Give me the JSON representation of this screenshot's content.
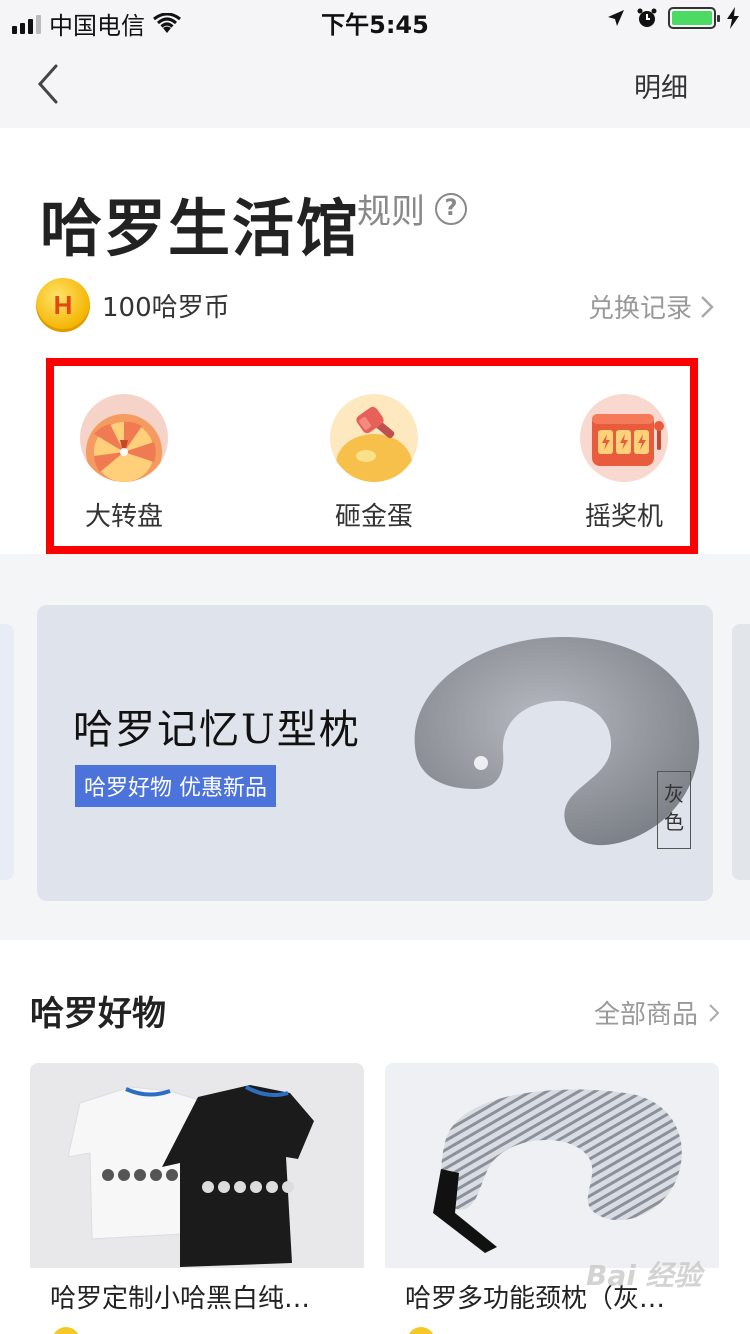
{
  "status_bar": {
    "carrier": "中国电信",
    "time": "下午5:45"
  },
  "nav": {
    "detail_label": "明细"
  },
  "header": {
    "title": "哈罗生活馆",
    "rules_label": "规则",
    "help_glyph": "?",
    "coin_glyph": "H",
    "coin_balance": "100哈罗币",
    "exchange_record": "兑换记录"
  },
  "games": [
    {
      "label": "大转盘",
      "icon": "wheel-icon"
    },
    {
      "label": "砸金蛋",
      "icon": "hammer-egg-icon"
    },
    {
      "label": "摇奖机",
      "icon": "slot-machine-icon"
    }
  ],
  "banner": {
    "title": "哈罗记忆U型枕",
    "tag": "哈罗好物 优惠新品",
    "color_label": "灰色"
  },
  "section": {
    "title": "哈罗好物",
    "all_goods": "全部商品"
  },
  "products": [
    {
      "name": "哈罗定制小哈黑白纯…"
    },
    {
      "name": "哈罗多功能颈枕（灰…"
    }
  ],
  "watermark": "Bai 经验",
  "colors": {
    "highlight_border": "#ff0000",
    "tag_blue": "#4b73d9",
    "battery_green": "#4cd964"
  }
}
